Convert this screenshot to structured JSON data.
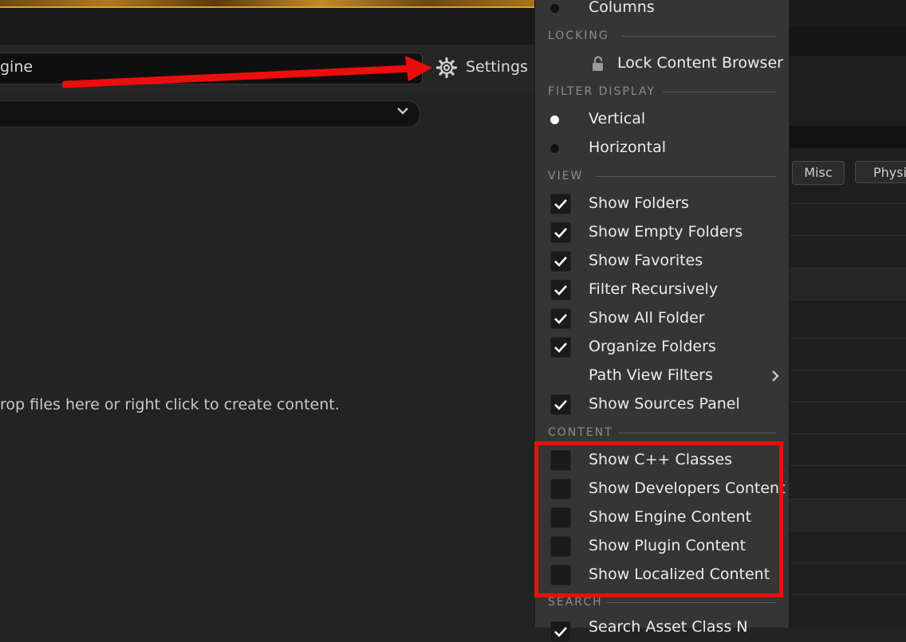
{
  "toolbar": {
    "path_text": "gine",
    "settings_label": "Settings"
  },
  "content": {
    "drop_hint": "rop files here or right click to create content."
  },
  "right_panel": {
    "chips": [
      "Misc",
      "Physi"
    ]
  },
  "menu": {
    "top_item": {
      "label": "Columns",
      "selected": false
    },
    "locking": {
      "header": "LOCKING",
      "item": "Lock Content Browser"
    },
    "filter_display": {
      "header": "FILTER DISPLAY",
      "items": [
        {
          "label": "Vertical",
          "selected": true
        },
        {
          "label": "Horizontal",
          "selected": false
        }
      ]
    },
    "view": {
      "header": "VIEW",
      "items": [
        {
          "label": "Show Folders",
          "checked": true
        },
        {
          "label": "Show Empty Folders",
          "checked": true
        },
        {
          "label": "Show Favorites",
          "checked": true
        },
        {
          "label": "Filter Recursively",
          "checked": true
        },
        {
          "label": "Show All Folder",
          "checked": true
        },
        {
          "label": "Organize Folders",
          "checked": true
        },
        {
          "label": "Path View Filters",
          "submenu": true
        },
        {
          "label": "Show Sources Panel",
          "checked": true
        }
      ]
    },
    "content": {
      "header": "CONTENT",
      "items": [
        {
          "label": "Show C++ Classes",
          "checked": false
        },
        {
          "label": "Show Developers Content",
          "checked": false
        },
        {
          "label": "Show Engine Content",
          "checked": false
        },
        {
          "label": "Show Plugin Content",
          "checked": false
        },
        {
          "label": "Show Localized Content",
          "checked": false
        }
      ]
    },
    "search": {
      "header": "SEARCH",
      "partial_item": "Search Asset Class N"
    }
  },
  "colors": {
    "highlight_red": "#ee0d0d",
    "menu_bg": "#353535",
    "checkbox_bg": "#1a1a1a"
  }
}
